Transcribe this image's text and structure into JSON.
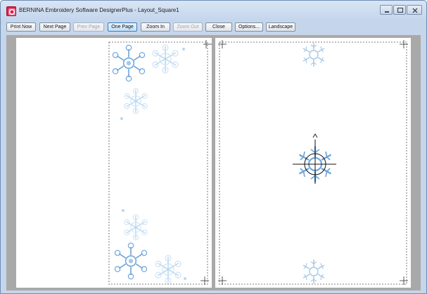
{
  "window": {
    "title": "BERNINA Embroidery Software DesignerPlus - Layout_Square1",
    "app_icon": "bernina-logo-icon",
    "controls": [
      "minimize-icon",
      "maximize-icon",
      "close-icon"
    ]
  },
  "toolbar": {
    "print_now": "Print Now",
    "next_page": "Next Page",
    "prev_page": "Prev Page",
    "one_page": "One Page",
    "zoom_in": "Zoom In",
    "zoom_out": "Zoom Out",
    "close": "Close",
    "options": "Options...",
    "landscape": "Landscape"
  },
  "preview": {
    "pages": 2,
    "motif": "snowflake",
    "colors": {
      "background": "#a9a9a9",
      "snowflake": "#6aa3d9",
      "snowflake_light": "#b9d7f0",
      "hoop_center": "#000000"
    }
  }
}
